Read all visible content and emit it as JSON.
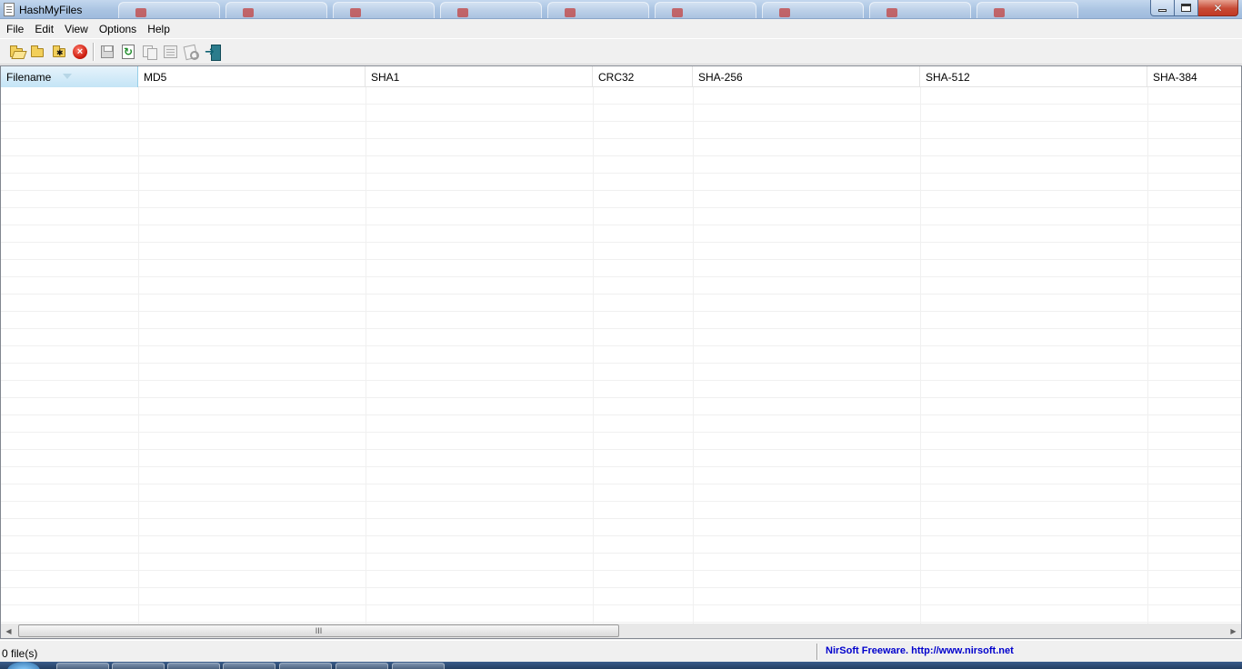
{
  "window": {
    "title": "HashMyFiles",
    "close_glyph": "✕"
  },
  "menu": [
    "File",
    "Edit",
    "View",
    "Options",
    "Help"
  ],
  "toolbar": {
    "icons": [
      "open-files-icon",
      "open-folder-icon",
      "open-folder-wildcard-icon",
      "clear-list-icon",
      "save-icon",
      "refresh-icon",
      "copy-icon",
      "properties-icon",
      "find-icon",
      "exit-icon"
    ]
  },
  "table": {
    "columns": [
      "Filename",
      "MD5",
      "SHA1",
      "CRC32",
      "SHA-256",
      "SHA-512",
      "SHA-384"
    ],
    "sorted_column": "Filename",
    "rows": []
  },
  "scrollbar": {
    "grip": "III"
  },
  "status": {
    "left": "0 file(s)",
    "right": "NirSoft Freeware.  http://www.nirsoft.net"
  },
  "colors": {
    "accent_link": "#0000cc",
    "sorted_header": "#c4e4f6"
  }
}
